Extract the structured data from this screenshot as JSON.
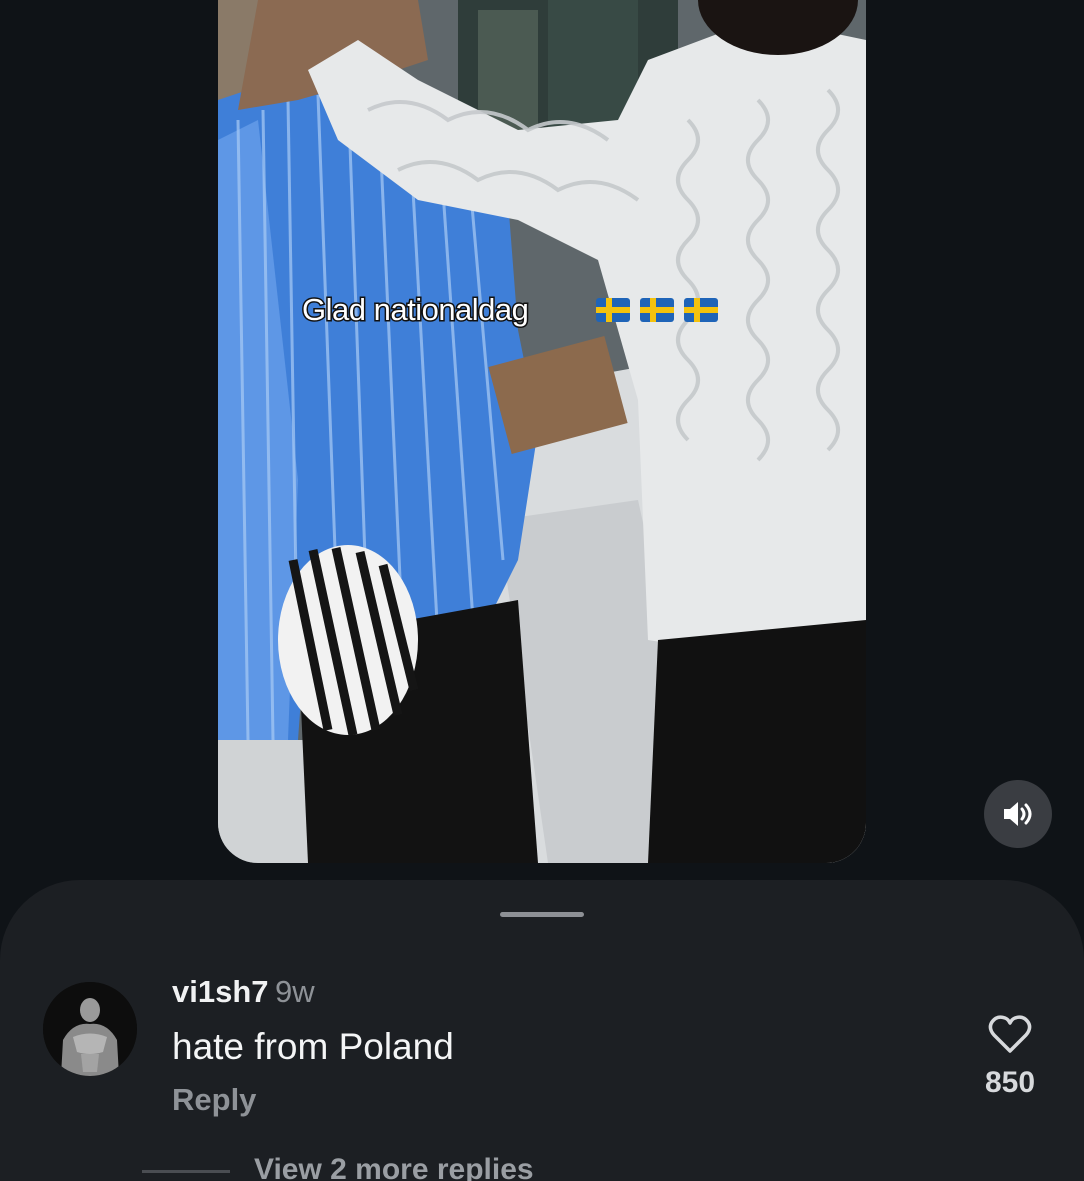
{
  "video": {
    "caption": "Glad nationaldag",
    "caption_flags": [
      "swedish-flag-icon",
      "swedish-flag-icon",
      "swedish-flag-icon"
    ],
    "sound_icon": "volume-on-icon"
  },
  "comment": {
    "username": "vi1sh7",
    "time": "9w",
    "text": "hate from Poland",
    "reply_label": "Reply",
    "like_icon": "heart-outline-icon",
    "like_count": "850",
    "view_replies_label": "View 2 more replies"
  },
  "colors": {
    "background": "#0f1317",
    "sheet": "#1c1f23",
    "muted_text": "#8e9297",
    "sweden_blue": "#1f64b8",
    "sweden_yellow": "#f4c20d"
  }
}
